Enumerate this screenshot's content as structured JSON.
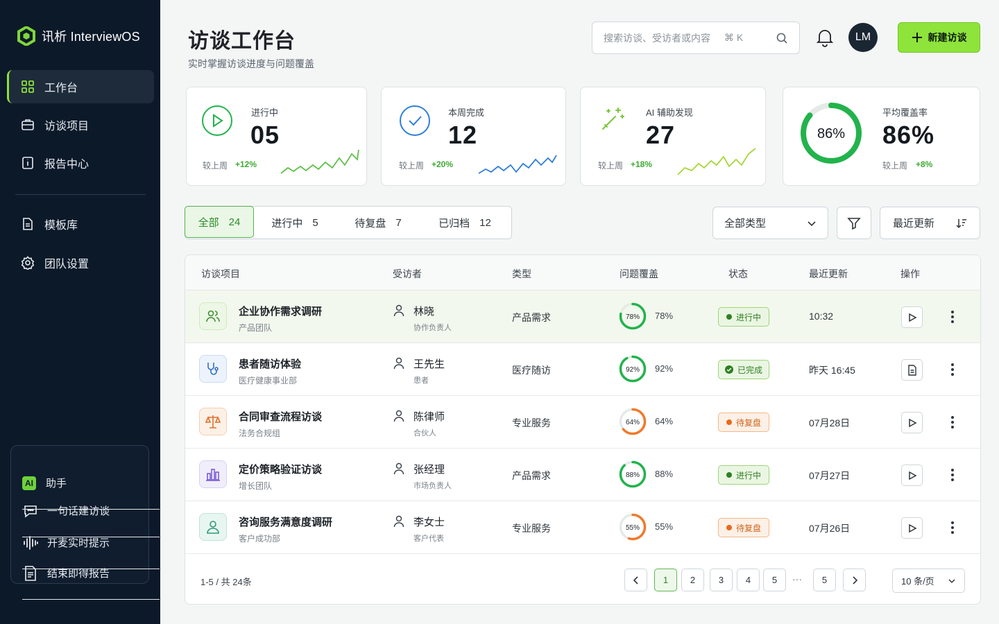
{
  "app": {
    "name": "讯析 InterviewOS"
  },
  "sidebar": {
    "items": [
      {
        "label": "工作台"
      },
      {
        "label": "访谈项目"
      },
      {
        "label": "报告中心"
      },
      {
        "label": "模板库"
      },
      {
        "label": "团队设置"
      }
    ],
    "assistant": {
      "badge": "AI",
      "title": "助手",
      "features": [
        "一句话建访谈",
        "开麦实时提示",
        "结束即得报告"
      ]
    }
  },
  "header": {
    "title": "访谈工作台",
    "subtitle": "实时掌握访谈进度与问题覆盖",
    "search_placeholder": "搜索访谈、受访者或内容",
    "search_shortcut": "⌘ K",
    "avatar_initials": "LM",
    "new_button": "新建访谈"
  },
  "stats": [
    {
      "label": "进行中",
      "value": "05",
      "compare_label": "较上周",
      "delta": "+12%"
    },
    {
      "label": "本周完成",
      "value": "12",
      "compare_label": "较上周",
      "delta": "+20%"
    },
    {
      "label": "AI 辅助发现",
      "value": "27",
      "compare_label": "较上周",
      "delta": "+18%"
    },
    {
      "label": "平均覆盖率",
      "value": "86%",
      "ring_text": "86%",
      "ring_value": 0.86,
      "compare_label": "较上周",
      "delta": "+8%"
    }
  ],
  "filters": {
    "tabs": [
      {
        "label": "全部",
        "count": "24"
      },
      {
        "label": "进行中",
        "count": "5"
      },
      {
        "label": "待复盘",
        "count": "7"
      },
      {
        "label": "已归档",
        "count": "12"
      }
    ],
    "type_select": "全部类型",
    "sort_select": "最近更新"
  },
  "table": {
    "headers": [
      "访谈项目",
      "受访者",
      "类型",
      "问题覆盖",
      "状态",
      "最近更新",
      "操作"
    ],
    "rows": [
      {
        "name": "企业协作需求调研",
        "team": "产品团队",
        "person": "林晓",
        "role": "协作负责人",
        "type": "产品需求",
        "coverage": "78%",
        "coverage_value": 0.78,
        "status": "进行中",
        "updated": "10:32"
      },
      {
        "name": "患者随访体验",
        "team": "医疗健康事业部",
        "person": "王先生",
        "role": "患者",
        "type": "医疗随访",
        "coverage": "92%",
        "coverage_value": 0.92,
        "status": "已完成",
        "updated": "昨天 16:45"
      },
      {
        "name": "合同审查流程访谈",
        "team": "法务合规组",
        "person": "陈律师",
        "role": "合伙人",
        "type": "专业服务",
        "coverage": "64%",
        "coverage_value": 0.64,
        "status": "待复盘",
        "updated": "07月28日"
      },
      {
        "name": "定价策略验证访谈",
        "team": "增长团队",
        "person": "张经理",
        "role": "市场负责人",
        "type": "产品需求",
        "coverage": "88%",
        "coverage_value": 0.88,
        "status": "进行中",
        "updated": "07月27日"
      },
      {
        "name": "咨询服务满意度调研",
        "team": "客户成功部",
        "person": "李女士",
        "role": "客户代表",
        "type": "专业服务",
        "coverage": "55%",
        "coverage_value": 0.55,
        "status": "待复盘",
        "updated": "07月26日"
      }
    ]
  },
  "pagination": {
    "info": "1-5 / 共 24条",
    "pages": [
      "1",
      "2",
      "3",
      "4",
      "5",
      "5"
    ],
    "ellipsis": "···",
    "per_page": "10 条/页"
  },
  "colors": {
    "accent": "#8ee43a",
    "sidebar_bg": "#0c1929",
    "green": "#22b34c",
    "orange": "#f07a2a"
  }
}
